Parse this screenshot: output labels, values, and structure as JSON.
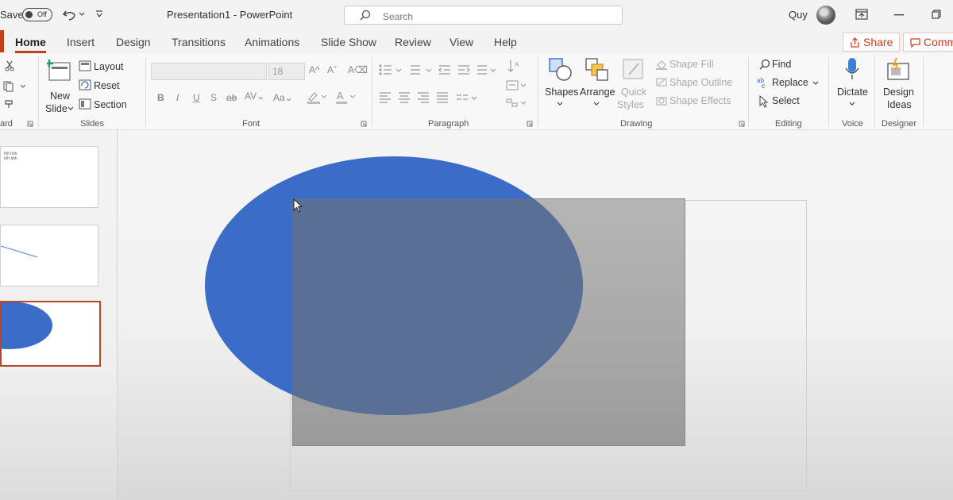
{
  "titlebar": {
    "autosave_label": "Save",
    "autosave_state": "Off",
    "doc_title": "Presentation1  -  PowerPoint",
    "search_placeholder": "Search",
    "user_name": "Quy"
  },
  "tabs": [
    "Home",
    "Insert",
    "Design",
    "Transitions",
    "Animations",
    "Slide Show",
    "Review",
    "View",
    "Help"
  ],
  "active_tab": "Home",
  "share": {
    "share_label": "Share",
    "comments_label": "Comm"
  },
  "ribbon": {
    "clipboard": {
      "group_label": "ard"
    },
    "slides": {
      "new_slide_line1": "New",
      "new_slide_line2": "Slide",
      "layout": "Layout",
      "reset": "Reset",
      "section": "Section",
      "group_label": "Slides"
    },
    "font": {
      "font_size": "18",
      "group_label": "Font",
      "bold": "B",
      "italic": "I",
      "underline": "U",
      "strike": "S"
    },
    "paragraph": {
      "group_label": "Paragraph"
    },
    "drawing": {
      "shapes": "Shapes",
      "arrange": "Arrange",
      "quick_styles_line1": "Quick",
      "quick_styles_line2": "Styles",
      "shape_fill": "Shape Fill",
      "shape_outline": "Shape Outline",
      "shape_effects": "Shape Effects",
      "group_label": "Drawing"
    },
    "editing": {
      "find": "Find",
      "replace": "Replace",
      "select": "Select",
      "group_label": "Editing"
    },
    "voice": {
      "dictate": "Dictate",
      "group_label": "Voice"
    },
    "designer": {
      "design_ideas_line1": "Design",
      "design_ideas_line2": "Ideas",
      "group_label": "Designer"
    }
  },
  "thumbnails": [
    {
      "text_line1": "hội tính",
      "text_line2": "ình ảnh"
    },
    {},
    {}
  ],
  "colors": {
    "accent": "#c43e1c",
    "ellipse_fill": "#3b6cc7",
    "rect_fill": "#a9a9a9",
    "overlap": "#5a6f96"
  }
}
